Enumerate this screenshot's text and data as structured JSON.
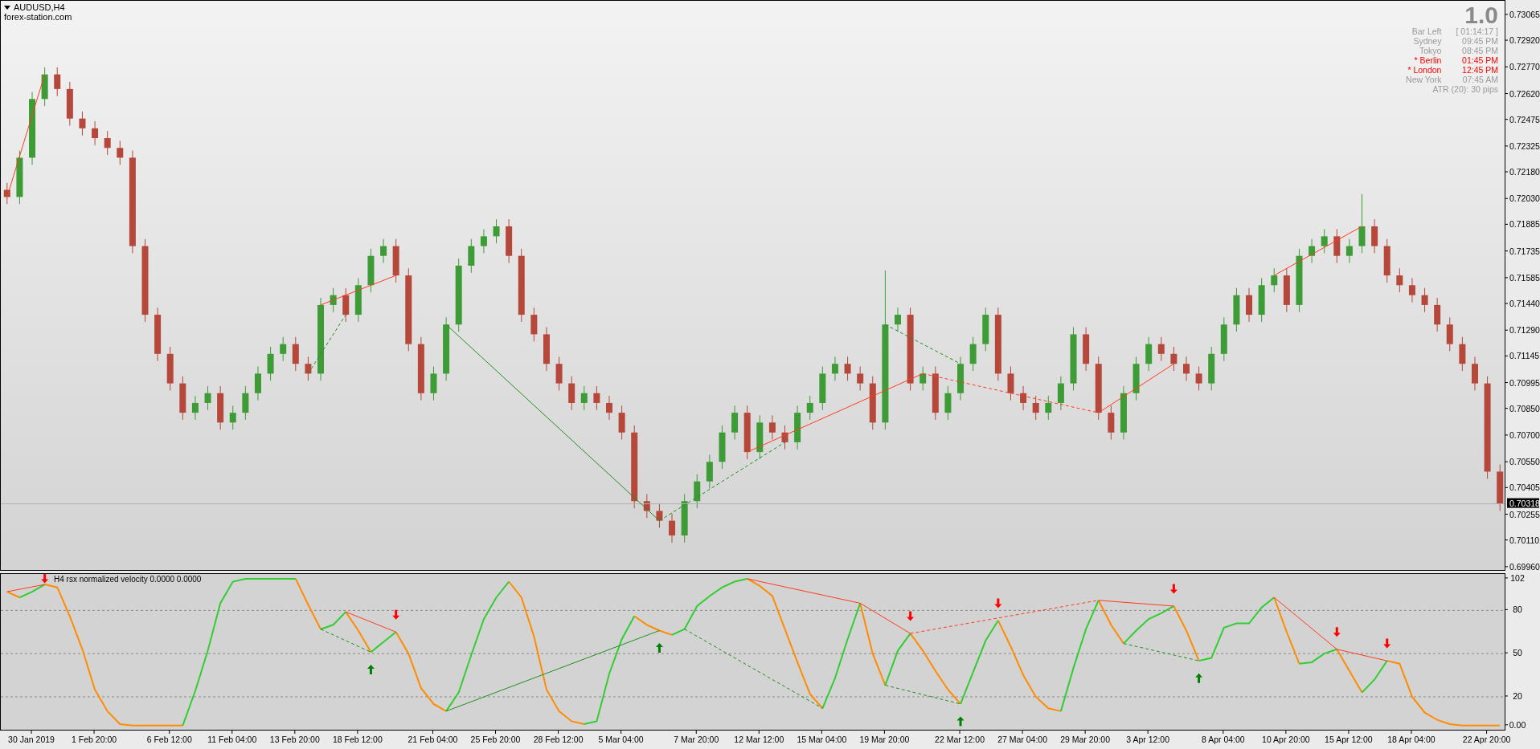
{
  "price_chart": {
    "header": {
      "symbol": "AUDUSD,H4",
      "source": "forex-station.com"
    },
    "info_panel": {
      "value": "1.0",
      "rows": [
        {
          "label": "Bar Left",
          "value": "[ 01:14:17 ]",
          "color": "#9a9a9a"
        },
        {
          "label": "Sydney",
          "value": "09:45 PM",
          "color": "#9a9a9a"
        },
        {
          "label": "Tokyo",
          "value": "08:45 PM",
          "color": "#9a9a9a"
        },
        {
          "label": "* Berlin",
          "value": "01:45 PM",
          "color": "#ff0000"
        },
        {
          "label": "* London",
          "value": "12:45 PM",
          "color": "#ff0000"
        },
        {
          "label": "New York",
          "value": "07:45 AM",
          "color": "#9a9a9a"
        }
      ],
      "footer": "ATR (20): 30 pips"
    },
    "current_price": "0.70318",
    "chart_data": {
      "type": "candlestick",
      "categories": [
        null,
        null,
        null,
        null,
        null,
        null,
        null,
        null,
        null,
        null,
        null,
        null,
        null,
        null,
        null,
        null,
        null,
        null,
        null,
        null,
        null,
        null,
        null,
        null,
        null,
        null,
        null,
        null,
        null,
        null,
        null,
        null,
        null,
        null,
        null,
        null,
        null,
        null,
        null,
        null,
        null,
        null,
        null,
        null,
        null,
        null,
        null,
        null,
        null,
        null,
        null,
        null,
        null,
        null,
        null,
        null,
        null,
        null,
        null,
        null,
        null,
        null,
        null,
        null,
        null,
        null,
        null,
        null,
        null,
        null,
        null,
        null,
        null,
        null,
        null,
        null,
        null,
        null,
        null,
        null,
        null,
        null,
        null,
        null,
        null,
        null,
        null,
        null,
        null,
        null,
        null,
        null,
        null,
        null,
        null,
        null,
        null,
        null,
        null,
        null,
        null,
        null,
        null,
        null,
        null,
        null,
        null,
        null,
        null,
        null,
        null,
        null,
        null,
        null,
        null,
        null,
        null,
        null,
        null,
        null
      ],
      "ylim": [
        0.69937,
        0.73146
      ],
      "yticks": [
        {
          "value": 0.73065,
          "label": "0.73065"
        },
        {
          "value": 0.7292,
          "label": "0.72920"
        },
        {
          "value": 0.7277,
          "label": "0.72770"
        },
        {
          "value": 0.7262,
          "label": "0.72620"
        },
        {
          "value": 0.72475,
          "label": "0.72475"
        },
        {
          "value": 0.72325,
          "label": "0.72325"
        },
        {
          "value": 0.7218,
          "label": "0.72180"
        },
        {
          "value": 0.7203,
          "label": "0.72030"
        },
        {
          "value": 0.71885,
          "label": "0.71885"
        },
        {
          "value": 0.71735,
          "label": "0.71735"
        },
        {
          "value": 0.71585,
          "label": "0.71585"
        },
        {
          "value": 0.7144,
          "label": "0.71440"
        },
        {
          "value": 0.7129,
          "label": "0.71290"
        },
        {
          "value": 0.71145,
          "label": "0.71145"
        },
        {
          "value": 0.70995,
          "label": "0.70995"
        },
        {
          "value": 0.7085,
          "label": "0.70850"
        },
        {
          "value": 0.707,
          "label": "0.70700"
        },
        {
          "value": 0.7055,
          "label": "0.70550"
        },
        {
          "value": 0.70405,
          "label": "0.70405"
        },
        {
          "value": 0.70255,
          "label": "0.70255"
        },
        {
          "value": 0.7011,
          "label": "0.70110"
        },
        {
          "value": 0.6996,
          "label": "0.69960"
        }
      ],
      "ohlc": [
        [
          0.72083,
          0.72123,
          0.72003,
          0.72043
        ],
        [
          0.72043,
          0.72304,
          0.72003,
          0.72264
        ],
        [
          0.72264,
          0.72634,
          0.72224,
          0.72594
        ],
        [
          0.72594,
          0.72772,
          0.72554,
          0.72732
        ],
        [
          0.72732,
          0.72772,
          0.7261,
          0.7265
        ],
        [
          0.7265,
          0.7269,
          0.72444,
          0.72484
        ],
        [
          0.72484,
          0.72524,
          0.72389,
          0.72429
        ],
        [
          0.72429,
          0.72469,
          0.72334,
          0.72374
        ],
        [
          0.72374,
          0.72414,
          0.72279,
          0.72319
        ],
        [
          0.72319,
          0.72359,
          0.72224,
          0.72264
        ],
        [
          0.72264,
          0.72304,
          0.71727,
          0.71767
        ],
        [
          0.71767,
          0.71807,
          0.71341,
          0.71381
        ],
        [
          0.71381,
          0.71421,
          0.71121,
          0.71161
        ],
        [
          0.71161,
          0.71201,
          0.70955,
          0.70995
        ],
        [
          0.70995,
          0.71035,
          0.7079,
          0.7083
        ],
        [
          0.7083,
          0.70925,
          0.7079,
          0.70885
        ],
        [
          0.70885,
          0.7098,
          0.70845,
          0.7094
        ],
        [
          0.7094,
          0.7098,
          0.70735,
          0.70775
        ],
        [
          0.70775,
          0.7087,
          0.70735,
          0.7083
        ],
        [
          0.7083,
          0.7098,
          0.7079,
          0.7094
        ],
        [
          0.7094,
          0.7109,
          0.709,
          0.7105
        ],
        [
          0.7105,
          0.71201,
          0.7101,
          0.71161
        ],
        [
          0.71161,
          0.71256,
          0.71121,
          0.71216
        ],
        [
          0.71216,
          0.71256,
          0.71065,
          0.71105
        ],
        [
          0.71105,
          0.71145,
          0.7101,
          0.7105
        ],
        [
          0.7105,
          0.71476,
          0.7101,
          0.71436
        ],
        [
          0.71436,
          0.71531,
          0.71396,
          0.71491
        ],
        [
          0.71491,
          0.71531,
          0.71341,
          0.71381
        ],
        [
          0.71381,
          0.71587,
          0.71341,
          0.71547
        ],
        [
          0.71547,
          0.71752,
          0.71507,
          0.71712
        ],
        [
          0.71712,
          0.71807,
          0.71672,
          0.71767
        ],
        [
          0.71767,
          0.71807,
          0.71562,
          0.71602
        ],
        [
          0.71602,
          0.71642,
          0.71176,
          0.71216
        ],
        [
          0.71216,
          0.71256,
          0.709,
          0.7094
        ],
        [
          0.7094,
          0.7109,
          0.709,
          0.7105
        ],
        [
          0.7105,
          0.71366,
          0.7101,
          0.71326
        ],
        [
          0.71326,
          0.71697,
          0.71286,
          0.71657
        ],
        [
          0.71657,
          0.71807,
          0.71617,
          0.71767
        ],
        [
          0.71767,
          0.71862,
          0.71727,
          0.71822
        ],
        [
          0.71822,
          0.71918,
          0.71782,
          0.71878
        ],
        [
          0.71878,
          0.71918,
          0.71672,
          0.71712
        ],
        [
          0.71712,
          0.71752,
          0.71341,
          0.71381
        ],
        [
          0.71381,
          0.71421,
          0.71231,
          0.71271
        ],
        [
          0.71271,
          0.71311,
          0.71065,
          0.71105
        ],
        [
          0.71105,
          0.71145,
          0.70955,
          0.70995
        ],
        [
          0.70995,
          0.71035,
          0.70845,
          0.70885
        ],
        [
          0.70885,
          0.7098,
          0.70845,
          0.7094
        ],
        [
          0.7094,
          0.7098,
          0.70845,
          0.70885
        ],
        [
          0.70885,
          0.70925,
          0.7079,
          0.7083
        ],
        [
          0.7083,
          0.7087,
          0.70679,
          0.70719
        ],
        [
          0.70719,
          0.70759,
          0.70293,
          0.70333
        ],
        [
          0.70333,
          0.70373,
          0.70238,
          0.70278
        ],
        [
          0.70278,
          0.70318,
          0.70183,
          0.70223
        ],
        [
          0.70223,
          0.70263,
          0.701,
          0.7014
        ],
        [
          0.7014,
          0.70373,
          0.701,
          0.70333
        ],
        [
          0.70333,
          0.70484,
          0.70293,
          0.70444
        ],
        [
          0.70444,
          0.70594,
          0.70404,
          0.70554
        ],
        [
          0.70554,
          0.70759,
          0.70514,
          0.70719
        ],
        [
          0.70719,
          0.7087,
          0.70679,
          0.7083
        ],
        [
          0.7083,
          0.7087,
          0.70569,
          0.70609
        ],
        [
          0.70609,
          0.70815,
          0.70569,
          0.70775
        ],
        [
          0.70775,
          0.70815,
          0.70679,
          0.70719
        ],
        [
          0.70719,
          0.70759,
          0.70624,
          0.70664
        ],
        [
          0.70664,
          0.7087,
          0.70624,
          0.7083
        ],
        [
          0.7083,
          0.70925,
          0.7079,
          0.70885
        ],
        [
          0.70885,
          0.7109,
          0.70845,
          0.7105
        ],
        [
          0.7105,
          0.71145,
          0.7101,
          0.71105
        ],
        [
          0.71105,
          0.71145,
          0.7101,
          0.7105
        ],
        [
          0.7105,
          0.7109,
          0.70955,
          0.70995
        ],
        [
          0.70995,
          0.71035,
          0.70735,
          0.70775
        ],
        [
          0.70775,
          0.7163,
          0.70735,
          0.71326
        ],
        [
          0.71326,
          0.71421,
          0.71286,
          0.71381
        ],
        [
          0.71381,
          0.71421,
          0.70955,
          0.70995
        ],
        [
          0.70995,
          0.7109,
          0.70955,
          0.7105
        ],
        [
          0.7105,
          0.7109,
          0.7079,
          0.7083
        ],
        [
          0.7083,
          0.7098,
          0.7079,
          0.7094
        ],
        [
          0.7094,
          0.71145,
          0.709,
          0.71105
        ],
        [
          0.71105,
          0.71256,
          0.71065,
          0.71216
        ],
        [
          0.71216,
          0.71421,
          0.71176,
          0.71381
        ],
        [
          0.71381,
          0.71421,
          0.7101,
          0.7105
        ],
        [
          0.7105,
          0.7109,
          0.709,
          0.7094
        ],
        [
          0.7094,
          0.7098,
          0.70845,
          0.70885
        ],
        [
          0.70885,
          0.70925,
          0.7079,
          0.7083
        ],
        [
          0.7083,
          0.70925,
          0.7079,
          0.70885
        ],
        [
          0.70885,
          0.71035,
          0.70845,
          0.70995
        ],
        [
          0.70995,
          0.71311,
          0.70955,
          0.71271
        ],
        [
          0.71271,
          0.71311,
          0.71065,
          0.71105
        ],
        [
          0.71105,
          0.71145,
          0.7079,
          0.7083
        ],
        [
          0.7083,
          0.7087,
          0.70679,
          0.70719
        ],
        [
          0.70719,
          0.7098,
          0.70679,
          0.7094
        ],
        [
          0.7094,
          0.71145,
          0.709,
          0.71105
        ],
        [
          0.71105,
          0.71256,
          0.71065,
          0.71216
        ],
        [
          0.71216,
          0.71256,
          0.71121,
          0.71161
        ],
        [
          0.71161,
          0.71201,
          0.71065,
          0.71105
        ],
        [
          0.71105,
          0.71145,
          0.7101,
          0.7105
        ],
        [
          0.7105,
          0.7109,
          0.70955,
          0.70995
        ],
        [
          0.70995,
          0.71201,
          0.70955,
          0.71161
        ],
        [
          0.71161,
          0.71366,
          0.71121,
          0.71326
        ],
        [
          0.71326,
          0.71531,
          0.71286,
          0.71491
        ],
        [
          0.71491,
          0.71531,
          0.71341,
          0.71381
        ],
        [
          0.71381,
          0.71587,
          0.71341,
          0.71547
        ],
        [
          0.71547,
          0.71642,
          0.71507,
          0.71602
        ],
        [
          0.71602,
          0.71642,
          0.71396,
          0.71436
        ],
        [
          0.71436,
          0.71752,
          0.71396,
          0.71712
        ],
        [
          0.71712,
          0.71807,
          0.71672,
          0.71767
        ],
        [
          0.71767,
          0.71862,
          0.71727,
          0.71822
        ],
        [
          0.71822,
          0.71862,
          0.71672,
          0.71712
        ],
        [
          0.71712,
          0.71807,
          0.71672,
          0.71767
        ],
        [
          0.71767,
          0.7206,
          0.71727,
          0.71878
        ],
        [
          0.71878,
          0.71918,
          0.71727,
          0.71767
        ],
        [
          0.71767,
          0.71807,
          0.71562,
          0.71602
        ],
        [
          0.71602,
          0.71642,
          0.71507,
          0.71547
        ],
        [
          0.71547,
          0.71587,
          0.71451,
          0.71491
        ],
        [
          0.71491,
          0.71531,
          0.71396,
          0.71436
        ],
        [
          0.71436,
          0.71476,
          0.71286,
          0.71326
        ],
        [
          0.71326,
          0.71366,
          0.71176,
          0.71216
        ],
        [
          0.71216,
          0.71256,
          0.71065,
          0.71105
        ],
        [
          0.71105,
          0.71145,
          0.70955,
          0.70995
        ],
        [
          0.70995,
          0.71035,
          0.70459,
          0.70499
        ],
        [
          0.70499,
          0.70539,
          0.70278,
          0.70318
        ]
      ]
    }
  },
  "indicator": {
    "label": "H4 rsx normalized velocity 0.0000 0.0000",
    "chart_data": {
      "type": "line",
      "grid": true,
      "ylim": [
        -4,
        105.3
      ],
      "yticks": [
        {
          "value": 102,
          "label": "102"
        },
        {
          "value": 80,
          "label": "80"
        },
        {
          "value": 50,
          "label": "50"
        },
        {
          "value": 20,
          "label": "20"
        },
        {
          "value": 0,
          "label": "0.00"
        }
      ],
      "categories": [
        null,
        null,
        "30 Jan 2019",
        null,
        null,
        null,
        null,
        "1 Feb 20:00",
        null,
        null,
        null,
        null,
        null,
        "6 Feb 12:00",
        null,
        null,
        null,
        null,
        "11 Feb 04:00",
        null,
        null,
        null,
        null,
        "13 Feb 20:00",
        null,
        null,
        null,
        null,
        "18 Feb 12:00",
        null,
        null,
        null,
        null,
        null,
        "21 Feb 04:00",
        null,
        null,
        null,
        null,
        "25 Feb 20:00",
        null,
        null,
        null,
        null,
        "28 Feb 12:00",
        null,
        null,
        null,
        null,
        "5 Mar 04:00",
        null,
        null,
        null,
        null,
        null,
        "7 Mar 20:00",
        null,
        null,
        null,
        null,
        "12 Mar 12:00",
        null,
        null,
        null,
        null,
        "15 Mar 04:00",
        null,
        null,
        null,
        null,
        "19 Mar 20:00",
        null,
        null,
        null,
        null,
        null,
        "22 Mar 12:00",
        null,
        null,
        null,
        null,
        "27 Mar 04:00",
        null,
        null,
        null,
        null,
        "29 Mar 20:00",
        null,
        null,
        null,
        null,
        "3 Apr 12:00",
        null,
        null,
        null,
        null,
        null,
        "8 Apr 04:00",
        null,
        null,
        null,
        null,
        "10 Apr 20:00",
        null,
        null,
        null,
        null,
        "15 Apr 12:00",
        null,
        null,
        null,
        null,
        "18 Apr 04:00",
        null,
        null,
        null,
        null,
        null,
        "22 Apr 20:00",
        null
      ],
      "series": [
        {
          "color": "#ff8c00",
          "values": [
            93,
            89,
            null,
            98,
            96,
            76,
            53,
            25,
            10,
            1,
            0,
            0,
            0,
            0,
            0,
            null,
            null,
            null,
            null,
            null,
            null,
            null,
            null,
            102,
            84,
            67,
            null,
            79,
            66,
            51,
            null,
            65,
            50,
            26,
            15,
            10,
            null,
            null,
            null,
            null,
            100,
            89,
            62,
            25,
            10,
            3,
            1,
            null,
            null,
            null,
            76,
            70,
            66,
            63,
            null,
            null,
            null,
            null,
            null,
            102,
            97,
            90,
            67,
            44,
            22,
            12,
            null,
            null,
            85,
            50,
            28,
            null,
            64,
            52,
            38,
            25,
            15,
            null,
            null,
            73,
            55,
            35,
            20,
            12,
            10,
            null,
            null,
            87,
            70,
            57,
            null,
            null,
            null,
            83,
            66,
            45,
            null,
            null,
            null,
            null,
            null,
            89,
            65,
            43,
            null,
            null,
            53,
            38,
            23,
            null,
            45,
            43,
            20,
            9,
            4,
            1,
            0,
            0,
            0,
            0
          ]
        },
        {
          "color": "#32cd32",
          "values": [
            null,
            89,
            93,
            98,
            null,
            null,
            null,
            null,
            null,
            null,
            null,
            null,
            null,
            null,
            0,
            24,
            52,
            85,
            100,
            102,
            102,
            102,
            102,
            102,
            null,
            67,
            70,
            79,
            null,
            51,
            58,
            65,
            null,
            null,
            null,
            10,
            23,
            49,
            74,
            89,
            100,
            null,
            null,
            null,
            null,
            null,
            1,
            3,
            36,
            60,
            76,
            null,
            null,
            63,
            67,
            83,
            90,
            96,
            100,
            102,
            null,
            null,
            null,
            null,
            null,
            12,
            33,
            60,
            85,
            null,
            28,
            52,
            64,
            null,
            null,
            null,
            15,
            37,
            59,
            73,
            null,
            null,
            null,
            null,
            10,
            40,
            67,
            87,
            null,
            57,
            66,
            74,
            78,
            83,
            null,
            45,
            47,
            68,
            71,
            71,
            82,
            89,
            null,
            43,
            44,
            50,
            53,
            null,
            23,
            32,
            45,
            null,
            null,
            null,
            null,
            null,
            null,
            null,
            null,
            null
          ]
        }
      ]
    }
  }
}
